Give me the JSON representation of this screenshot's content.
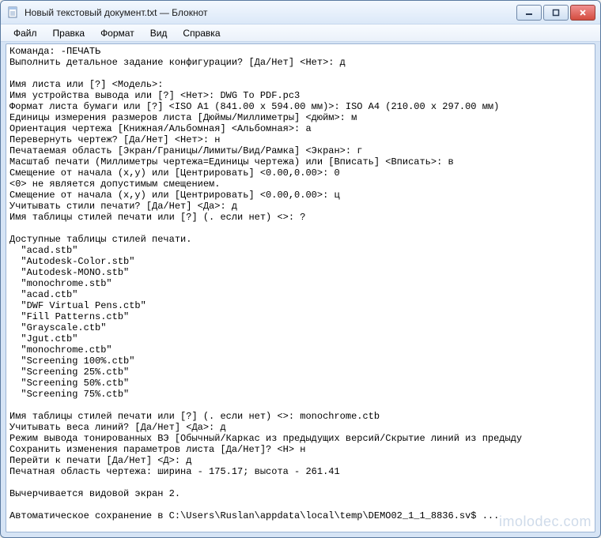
{
  "title": "Новый текстовый документ.txt — Блокнот",
  "menu": {
    "file": "Файл",
    "edit": "Правка",
    "format": "Формат",
    "view": "Вид",
    "help": "Справка"
  },
  "content": "Команда: -ПЕЧАТЬ\nВыполнить детальное задание конфигурации? [Да/Нет] <Нет>: д\n\nИмя листа или [?] <Модель>:\nИмя устройства вывода или [?] <Нет>: DWG To PDF.pc3\nФормат листа бумаги или [?] <ISO A1 (841.00 x 594.00 мм)>: ISO A4 (210.00 x 297.00 мм)\nЕдиницы измерения размеров листа [Дюймы/Миллиметры] <дюйм>: м\nОриентация чертежа [Книжная/Альбомная] <Альбомная>: а\nПеревернуть чертеж? [Да/Нет] <Нет>: н\nПечатаемая область [Экран/Границы/Лимиты/Вид/Рамка] <Экран>: г\nМасштаб печати (Миллиметры чертежа=Единицы чертежа) или [Вписать] <Вписать>: в\nСмещение от начала (x,y) или [Центрировать] <0.00,0.00>: 0\n<0> не является допустимым смещением.\nСмещение от начала (x,y) или [Центрировать] <0.00,0.00>: ц\nУчитывать стили печати? [Да/Нет] <Да>: д\nИмя таблицы стилей печати или [?] (. если нет) <>: ?\n\nДоступные таблицы стилей печати.\n  \"acad.stb\"\n  \"Autodesk-Color.stb\"\n  \"Autodesk-MONO.stb\"\n  \"monochrome.stb\"\n  \"acad.ctb\"\n  \"DWF Virtual Pens.ctb\"\n  \"Fill Patterns.ctb\"\n  \"Grayscale.ctb\"\n  \"Jgut.ctb\"\n  \"monochrome.ctb\"\n  \"Screening 100%.ctb\"\n  \"Screening 25%.ctb\"\n  \"Screening 50%.ctb\"\n  \"Screening 75%.ctb\"\n\nИмя таблицы стилей печати или [?] (. если нет) <>: monochrome.ctb\nУчитывать веса линий? [Да/Нет] <Да>: д\nРежим вывода тонированных ВЭ [Обычный/Каркас из предыдущих версий/Скрытие линий из предыду\nСохранить изменения параметров листа [Да/Нет]? <Н> н\nПерейти к печати [Да/Нет] <Д>: д\nПечатная область чертежа: ширина - 175.17; высота - 261.41\n\nВычерчивается видовой экран 2.\n\nАвтоматическое сохранение в C:\\Users\\Ruslan\\appdata\\local\\temp\\DEMO02_1_1_8836.sv$ ...\n",
  "watermark": "imolodec.com"
}
